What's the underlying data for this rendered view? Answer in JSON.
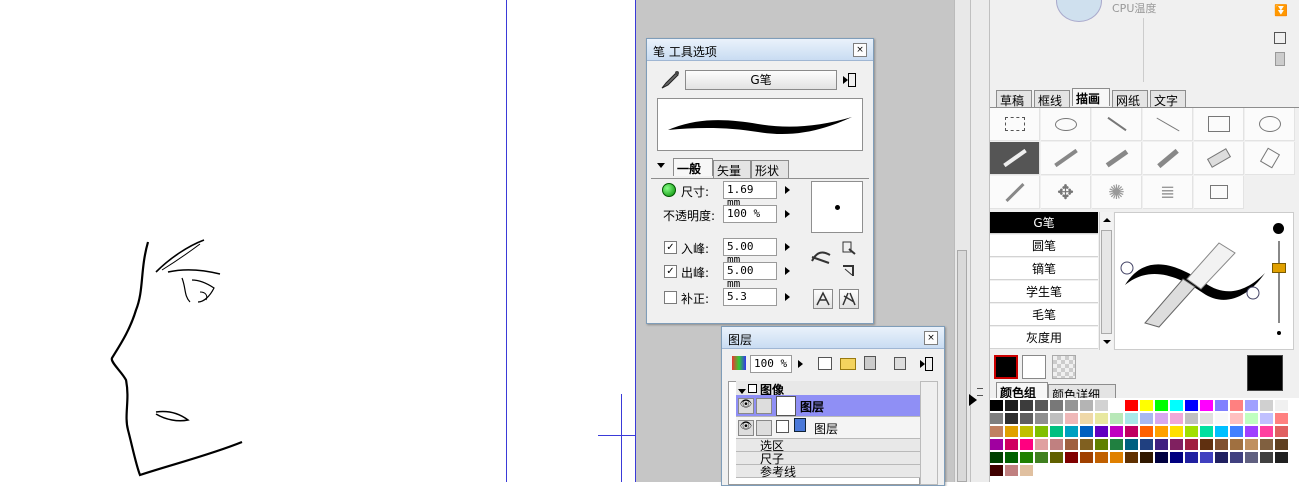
{
  "pen_palette": {
    "title": "笔 工具选项",
    "close": "×",
    "brush_name": "G笔",
    "tabs": [
      "一般",
      "矢量",
      "形状"
    ],
    "size_label": "尺寸:",
    "size_value": "1.69 mm",
    "opacity_label": "不透明度:",
    "opacity_value": "100 %",
    "in_label": "入峰:",
    "in_value": "5.00 mm",
    "in_checked": true,
    "out_label": "出峰:",
    "out_value": "5.00 mm",
    "out_checked": true,
    "correction_label": "补正:",
    "correction_value": "5.3",
    "correction_checked": false
  },
  "layer_palette": {
    "title": "图层",
    "close": "×",
    "opacity_value": "100 %",
    "folder_image": "图像",
    "layer1": "图层",
    "layer2": "图层",
    "folder_selection": "选区",
    "folder_ruler": "尺子",
    "folder_guides": "参考线"
  },
  "right_panel": {
    "cpu_label": "CPU温度",
    "tool_tabs": [
      "草稿",
      "框线",
      "描画",
      "网纸",
      "文字"
    ],
    "active_tool_tab": 2,
    "subtools": [
      "G笔",
      "圆笔",
      "镝笔",
      "学生笔",
      "毛笔",
      "灰度用"
    ],
    "selected_subtool": 0,
    "color_tabs": [
      "颜色组",
      "颜色详细"
    ],
    "main_color": "#000000",
    "sub_color": "#ffffff",
    "accent_color": "#cc0000"
  },
  "swatches": {
    "row1": [
      "#000000",
      "#1e1e1e",
      "#3c3c3c",
      "#5a5a5a",
      "#787878",
      "#969696",
      "#b4b4b4",
      "#d2d2d2",
      "#ffffff",
      "#ff0000",
      "#ffff00",
      "#00ff00",
      "#00ffff",
      "#0000ff",
      "#ff00ff",
      "#8080ff",
      "#ff8080",
      "#a0a0ff",
      "#d0d0d0",
      "#f0f0f0"
    ],
    "row2": [
      "#7f7f7f",
      "#2f2f2f",
      "#5f5f5f",
      "#8f8f8f",
      "#bfbfbf",
      "#efb8b8",
      "#efd8a8",
      "#e8e8a0",
      "#b8e8b8",
      "#a8e8e8",
      "#a8b8f0",
      "#d8a8f0",
      "#f0a8d8",
      "#c0c0c0",
      "#e0e0e0",
      "#f8f8f8",
      "#ffc0c0",
      "#c0ffc0",
      "#c0c0ff",
      "#ff8080"
    ],
    "row3": [
      "#c08060",
      "#e0a000",
      "#c0c000",
      "#80c000",
      "#00c080",
      "#00a0c0",
      "#0060c0",
      "#6000c0",
      "#c000c0",
      "#c00060",
      "#ff6000",
      "#ffa000",
      "#ffe000",
      "#a0e000",
      "#00e0a0",
      "#00c0ff",
      "#4080ff",
      "#a040ff",
      "#ff40a0",
      "#e06060"
    ],
    "row4": [
      "#a000a0",
      "#d00060",
      "#ff0080",
      "#e0a0a0",
      "#c08080",
      "#a06040",
      "#806020",
      "#608000",
      "#208040",
      "#006080",
      "#204080",
      "#402080",
      "#802060",
      "#a02040",
      "#603010",
      "#805030",
      "#a07040",
      "#c09060",
      "#806040",
      "#604020"
    ],
    "row5": [
      "#004000",
      "#006000",
      "#208000",
      "#408020",
      "#606000",
      "#800000",
      "#a04000",
      "#c06000",
      "#e08000",
      "#603000",
      "#301800",
      "#000040",
      "#000080",
      "#2020a0",
      "#4040c0",
      "#202060",
      "#404080",
      "#606080",
      "#404040",
      "#202020"
    ],
    "row6": [
      "#400000",
      "#c08080",
      "#e0c0a0"
    ]
  },
  "icons": {
    "pen": "pen-icon",
    "menu": "palette-menu-icon",
    "eye": "eye-icon",
    "trash": "trash-icon",
    "folder": "folder-icon",
    "lock": "lock-icon"
  }
}
